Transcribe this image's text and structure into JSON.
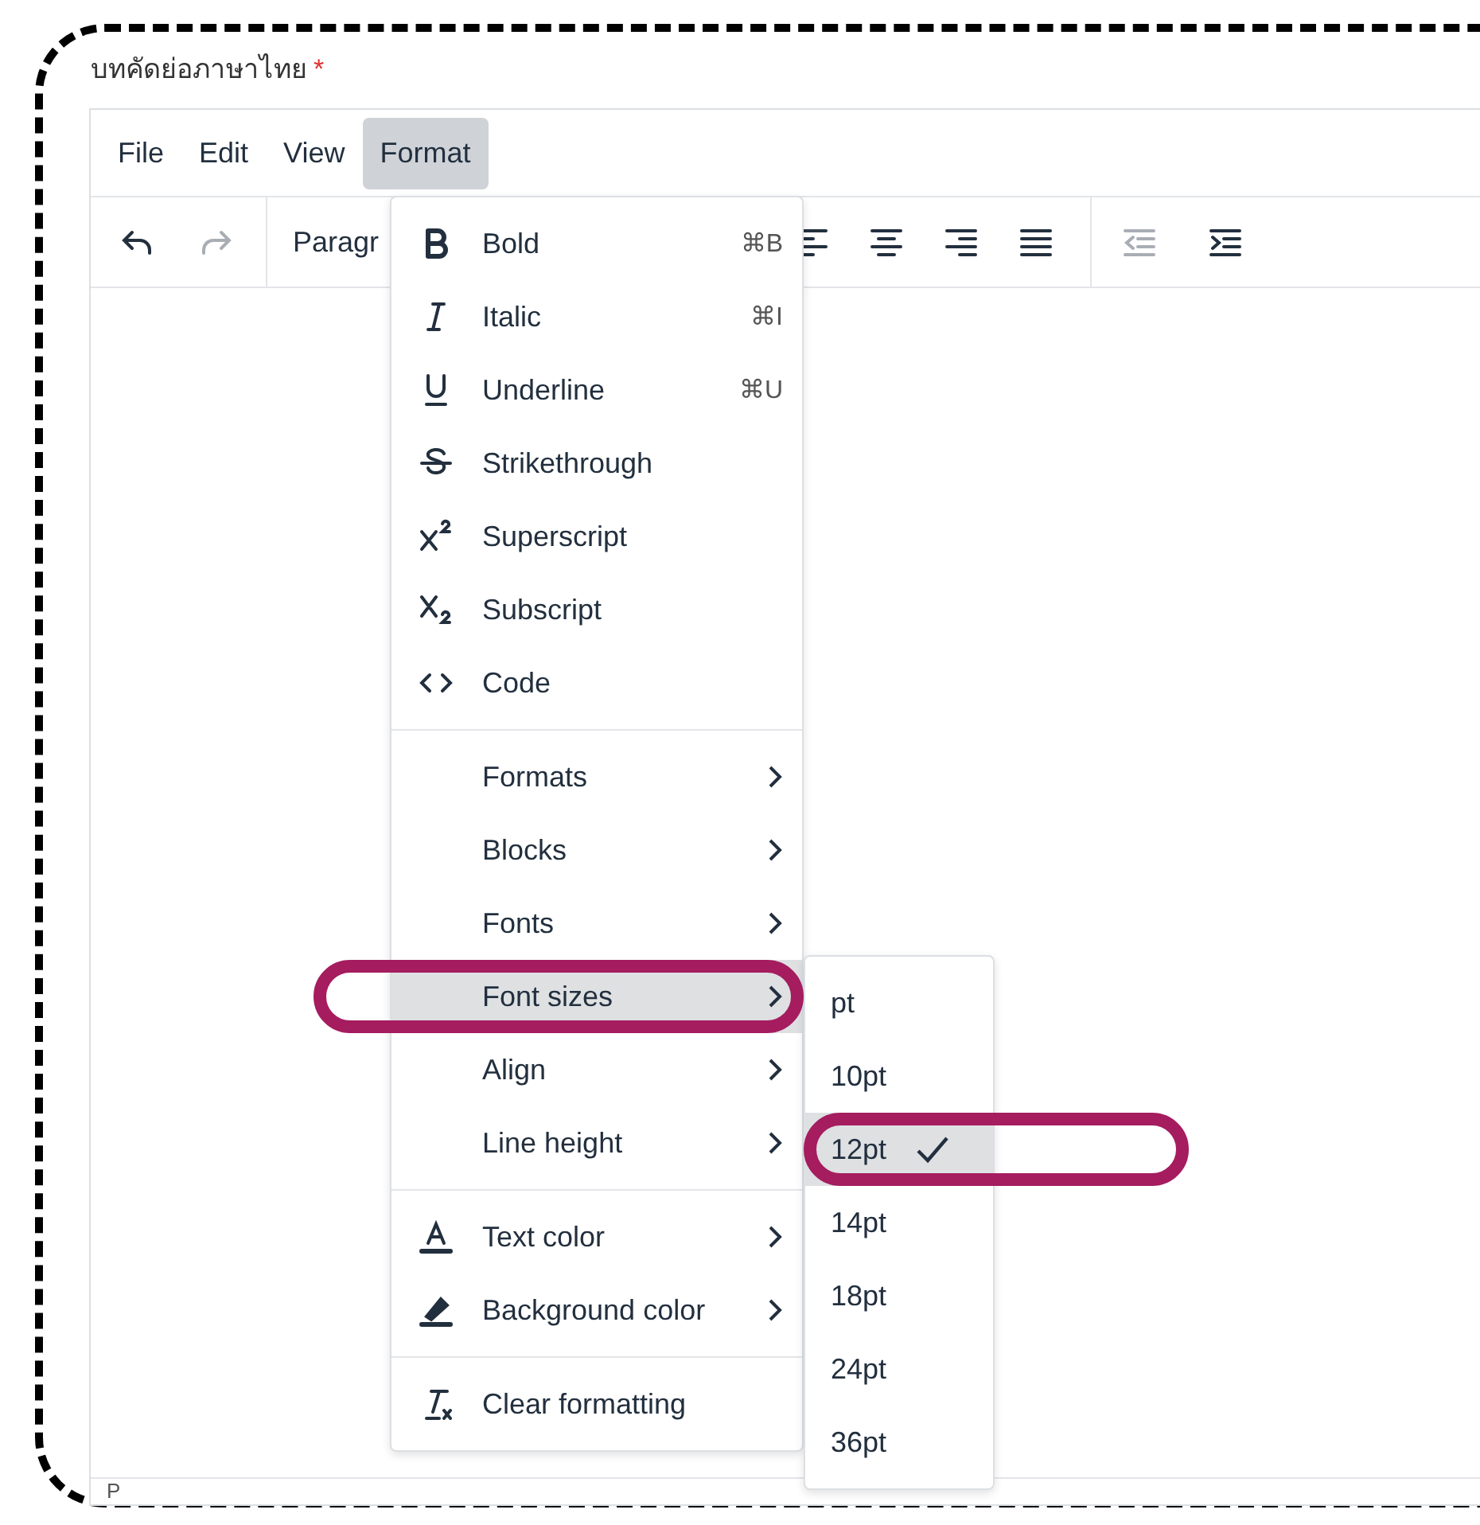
{
  "field_label": {
    "text": "บทคัดย่อภาษาไทย",
    "required_mark": "*"
  },
  "menubar": [
    {
      "label": "File",
      "selected": false
    },
    {
      "label": "Edit",
      "selected": false
    },
    {
      "label": "View",
      "selected": false
    },
    {
      "label": "Format",
      "selected": true
    }
  ],
  "toolbar": {
    "history": [
      {
        "kind": "undo",
        "disabled": false
      },
      {
        "kind": "redo",
        "disabled": true
      }
    ],
    "block_format": "Paragr",
    "align": [
      {
        "kind": "align-left"
      },
      {
        "kind": "align-center"
      },
      {
        "kind": "align-right"
      },
      {
        "kind": "justify"
      }
    ],
    "indent": [
      {
        "kind": "outdent",
        "disabled": true
      },
      {
        "kind": "indent",
        "disabled": false
      }
    ]
  },
  "format_menu": [
    [
      {
        "label": "Bold",
        "shortcut": "⌘B",
        "submenu": false,
        "selected": false
      },
      {
        "label": "Italic",
        "shortcut": "⌘I",
        "submenu": false,
        "selected": false
      },
      {
        "label": "Underline",
        "shortcut": "⌘U",
        "submenu": false,
        "selected": false
      },
      {
        "label": "Strikethrough",
        "submenu": false,
        "selected": false
      },
      {
        "label": "Superscript",
        "submenu": false,
        "selected": false
      },
      {
        "label": "Subscript",
        "submenu": false,
        "selected": false
      },
      {
        "label": "Code",
        "submenu": false,
        "selected": false
      }
    ],
    [
      {
        "label": "Formats",
        "submenu": true,
        "selected": false
      },
      {
        "label": "Blocks",
        "submenu": true,
        "selected": false
      },
      {
        "label": "Fonts",
        "submenu": true,
        "selected": false
      },
      {
        "label": "Font sizes",
        "submenu": true,
        "selected": true
      },
      {
        "label": "Align",
        "submenu": true,
        "selected": false
      },
      {
        "label": "Line height",
        "submenu": true,
        "selected": false
      }
    ],
    [
      {
        "label": "Text color",
        "submenu": true,
        "selected": false
      },
      {
        "label": "Background color",
        "submenu": true,
        "selected": false
      }
    ],
    [
      {
        "label": "Clear formatting",
        "submenu": false,
        "selected": false
      }
    ]
  ],
  "font_size_menu": [
    {
      "label": "pt",
      "selected": false
    },
    {
      "label": "10pt",
      "selected": false
    },
    {
      "label": "12pt",
      "selected": true
    },
    {
      "label": "14pt",
      "selected": false
    },
    {
      "label": "18pt",
      "selected": false
    },
    {
      "label": "24pt",
      "selected": false
    },
    {
      "label": "36pt",
      "selected": false
    }
  ],
  "status_bar": {
    "path": "P"
  }
}
